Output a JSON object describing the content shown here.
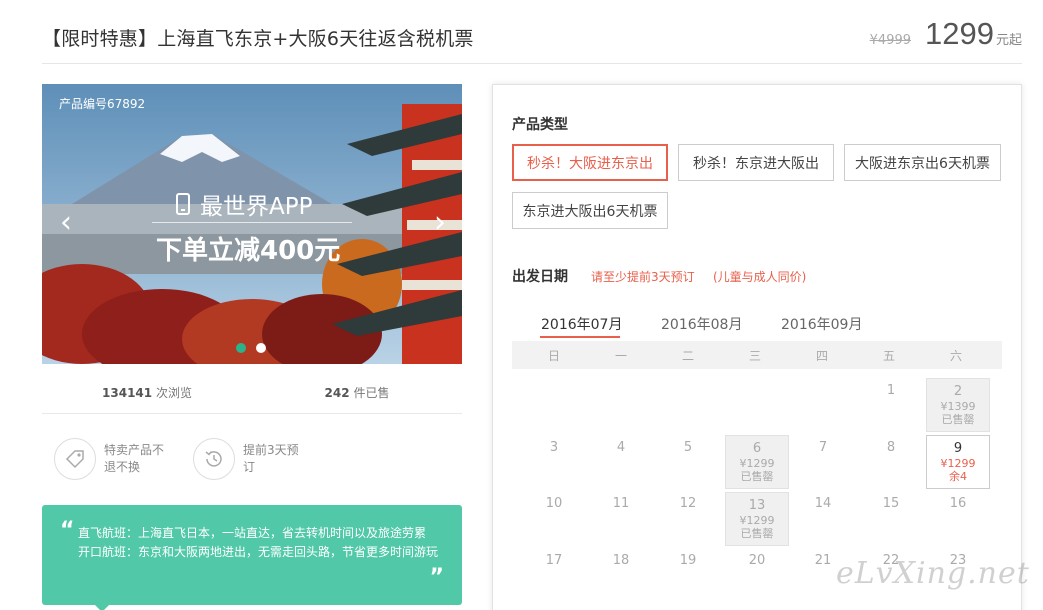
{
  "header": {
    "title": "【限时特惠】上海直飞东京+大阪6天往返含税机票",
    "price_old": "¥4999",
    "price_now": "1299",
    "price_unit": "元起"
  },
  "banner": {
    "product_id": "产品编号67892",
    "promo_line1": "最世界APP",
    "promo_line2": "下单立减400元",
    "slides": 2,
    "active_slide": 1
  },
  "stats": {
    "views_count": "134141",
    "views_label": "次浏览",
    "sold_count": "242",
    "sold_label": "件已售"
  },
  "features": {
    "no_refund": "特卖产品不退不换",
    "advance": "提前3天预订"
  },
  "notice": {
    "line1": "直飞航班：上海直飞日本，一站直达，省去转机时间以及旅途劳累",
    "line2": "开口航班：东京和大阪两地进出，无需走回头路，节省更多时间游玩"
  },
  "product_type": {
    "label": "产品类型",
    "options": [
      {
        "label": "秒杀！大阪进东京出",
        "selected": true
      },
      {
        "label": "秒杀！东京进大阪出",
        "selected": false
      },
      {
        "label": "大阪进东京出6天机票",
        "selected": false
      },
      {
        "label": "东京进大阪出6天机票",
        "selected": false
      }
    ]
  },
  "departure": {
    "label": "出发日期",
    "note1": "请至少提前3天预订",
    "note2": "(儿童与成人同价)"
  },
  "calendar": {
    "months": [
      "2016年07月",
      "2016年08月",
      "2016年09月"
    ],
    "active_month": 0,
    "weekdays": [
      "日",
      "一",
      "二",
      "三",
      "四",
      "五",
      "六"
    ],
    "days": [
      {
        "d": "1"
      },
      {
        "d": "2",
        "price": "¥1399",
        "status": "已售罄"
      },
      {
        "d": "3"
      },
      {
        "d": "4"
      },
      {
        "d": "5"
      },
      {
        "d": "6",
        "price": "¥1299",
        "status": "已售罄"
      },
      {
        "d": "7"
      },
      {
        "d": "8"
      },
      {
        "d": "9",
        "price": "¥1299",
        "status": "余4",
        "available": true
      },
      {
        "d": "10"
      },
      {
        "d": "11"
      },
      {
        "d": "12"
      },
      {
        "d": "13",
        "price": "¥1299",
        "status": "已售罄"
      },
      {
        "d": "14"
      },
      {
        "d": "15"
      },
      {
        "d": "16"
      },
      {
        "d": "17"
      },
      {
        "d": "18"
      },
      {
        "d": "19"
      },
      {
        "d": "20"
      },
      {
        "d": "21"
      },
      {
        "d": "22"
      },
      {
        "d": "23"
      }
    ]
  },
  "watermark": "eLvXing.net",
  "colors": {
    "accent": "#e8604c",
    "green": "#51c8a8",
    "dot_active": "#2bb38c"
  }
}
